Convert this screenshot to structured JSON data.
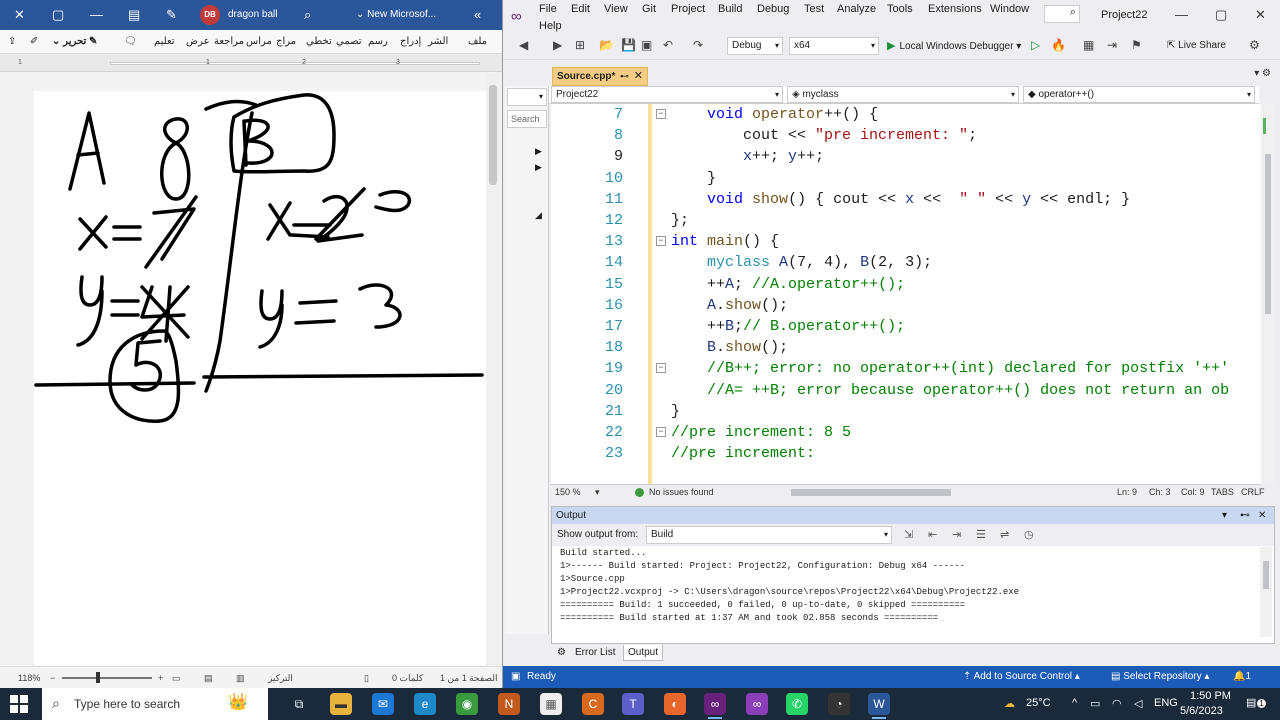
{
  "word": {
    "title_bar": {
      "close": "✕",
      "doc_title": "New Microsof...",
      "user_initials": "DB",
      "user_name": "dragon ball"
    },
    "ribbon_tabs": [
      "ملف",
      "الشر",
      "إدراج",
      "رسم",
      "تصمي",
      "تخطي",
      "مراج",
      "مراس",
      "مراجعة",
      "عرض",
      "تعليم"
    ],
    "editing_button": "تحرير",
    "ruler_ticks": [
      "1",
      "1",
      "2",
      "3"
    ],
    "status": {
      "zoom": "118%",
      "focus": "التركيز",
      "words": "0 كلمات",
      "page": "الصفحة 1 من 1"
    }
  },
  "vs": {
    "menu": [
      "File",
      "Edit",
      "View",
      "Git",
      "Project",
      "Build",
      "Debug",
      "Test",
      "Analyze",
      "Tools",
      "Extensions",
      "Window",
      "Help"
    ],
    "project_title": "Project22",
    "toolbar": {
      "config": "Debug",
      "platform": "x64",
      "run_label": "Local Windows Debugger",
      "live_share": "Live Share"
    },
    "left_panel": {
      "search": "Search"
    },
    "tab": {
      "label": "Source.cpp*",
      "pin": "⊷",
      "close": "✕"
    },
    "nav": {
      "project": "Project22",
      "scope": "myclass",
      "member": "operator++()"
    },
    "code_lines": [
      {
        "n": "7",
        "fold": "−",
        "html_key": "l7"
      },
      {
        "n": "8",
        "fold": "",
        "html_key": "l8"
      },
      {
        "n": "9",
        "fold": "",
        "html_key": "l9"
      },
      {
        "n": "10",
        "fold": "",
        "html_key": "l10"
      },
      {
        "n": "11",
        "fold": "",
        "html_key": "l11"
      },
      {
        "n": "12",
        "fold": "",
        "html_key": "l12"
      },
      {
        "n": "13",
        "fold": "−",
        "html_key": "l13"
      },
      {
        "n": "14",
        "fold": "",
        "html_key": "l14"
      },
      {
        "n": "15",
        "fold": "",
        "html_key": "l15"
      },
      {
        "n": "16",
        "fold": "",
        "html_key": "l16"
      },
      {
        "n": "17",
        "fold": "",
        "html_key": "l17"
      },
      {
        "n": "18",
        "fold": "",
        "html_key": "l18"
      },
      {
        "n": "19",
        "fold": "−",
        "html_key": "l19"
      },
      {
        "n": "20",
        "fold": "",
        "html_key": "l20"
      },
      {
        "n": "21",
        "fold": "",
        "html_key": "l21"
      },
      {
        "n": "22",
        "fold": "−",
        "html_key": "l22"
      },
      {
        "n": "23",
        "fold": "",
        "html_key": "l23"
      }
    ],
    "code_text": {
      "l7": "    void operator++() {",
      "l8": "        cout << \"pre increment: \";",
      "l9": "        x++; y++;",
      "l10": "    }",
      "l11": "    void show() { cout << x <<  \" \" << y << endl; }",
      "l12": "};",
      "l13": "int main() {",
      "l14": "    myclass A(7, 4), B(2, 3);",
      "l15": "    ++A; //A.operator++();",
      "l16": "    A.show();",
      "l17": "    ++B;// B.operator++();",
      "l18": "    B.show();",
      "l19": "    //B++; error: no operator++(int) declared for postfix '++'",
      "l20": "    //A= ++B; error because operator++() does not return an ob",
      "l21": "}",
      "l22": "//pre increment: 8 5",
      "l23": "//pre increment:"
    },
    "editor_status": {
      "zoom": "150 %",
      "issues": "No issues found",
      "ln": "Ln: 9",
      "ch": "Ch: 3",
      "col": "Col: 9",
      "tabs": "TABS",
      "eol": "CRLF"
    },
    "output": {
      "title": "Output",
      "show_from_label": "Show output from:",
      "source": "Build",
      "lines": [
        "Build started...",
        "1>------ Build started: Project: Project22, Configuration: Debug x64 ------",
        "1>Source.cpp",
        "1>Project22.vcxproj -> C:\\Users\\dragon\\source\\repos\\Project22\\x64\\Debug\\Project22.exe",
        "========== Build: 1 succeeded, 0 failed, 0 up-to-date, 0 skipped ==========",
        "========== Build started at 1:37 AM and took 02.858 seconds =========="
      ]
    },
    "bottom_tabs": [
      "Error List",
      "Output"
    ],
    "status": {
      "ready": "Ready",
      "source_control": "Add to Source Control",
      "repository": "Select Repository",
      "notifications": "1"
    }
  },
  "taskbar": {
    "search_placeholder": "Type here to search",
    "weather": "25°C",
    "lang": "ENG",
    "time": "1:50 PM",
    "date": "5/6/2023",
    "notify_count": "1"
  },
  "colors": {
    "word_blue": "#2b579a",
    "vs_status_blue": "#1c5cb8",
    "tab_gold": "#f5cc84",
    "keyword": "#0000ff",
    "comment": "#008000",
    "string": "#a31515"
  }
}
